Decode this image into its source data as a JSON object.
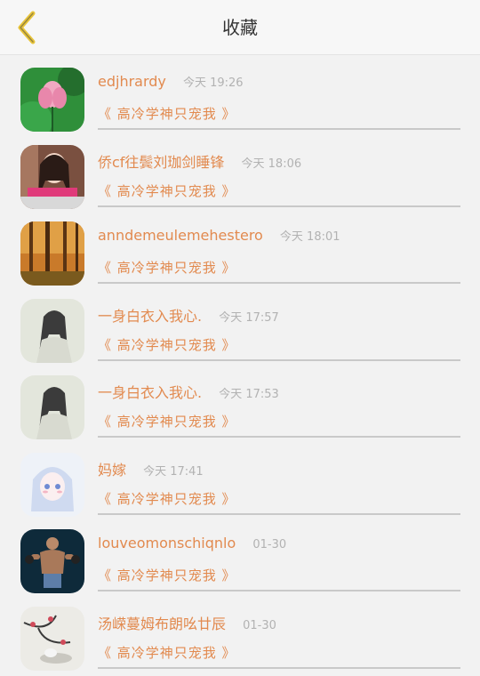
{
  "header": {
    "title": "收藏",
    "back_icon": "chevron-left-icon",
    "accent": "#e8c43a"
  },
  "items": [
    {
      "name": "edjhrardy",
      "time": "今天 19:26",
      "message": "《 高冷学神只宠我 》",
      "avatar": "lotus-flower"
    },
    {
      "name": "侨cf往鬓刘珈剑睡锋",
      "time": "今天 18:06",
      "message": "《 高冷学神只宠我 》",
      "avatar": "portrait-woman"
    },
    {
      "name": "anndemeulemehestero",
      "time": "今天 18:01",
      "message": "《 高冷学神只宠我 》",
      "avatar": "autumn-forest"
    },
    {
      "name": "一身白衣入我心.",
      "time": "今天 17:57",
      "message": "《 高冷学神只宠我 》",
      "avatar": "ink-painting-figure"
    },
    {
      "name": "一身白衣入我心.",
      "time": "今天 17:53",
      "message": "《 高冷学神只宠我 》",
      "avatar": "ink-painting-figure"
    },
    {
      "name": "妈嫁",
      "time": "今天 17:41",
      "message": "《 高冷学神只宠我 》",
      "avatar": "anime-girl"
    },
    {
      "name": "louveomonschiqnlo",
      "time": "01-30",
      "message": "《 高冷学神只宠我 》",
      "avatar": "athlete"
    },
    {
      "name": "汤嵘蔓姆布朗吆廿辰",
      "time": "01-30",
      "message": "《 高冷学神只宠我 》",
      "avatar": "plum-blossom-painting"
    }
  ],
  "colors": {
    "name": "#e28a4f",
    "time": "#b2b2b2",
    "divider": "#c9c9c9",
    "background": "#f2f2f2"
  }
}
